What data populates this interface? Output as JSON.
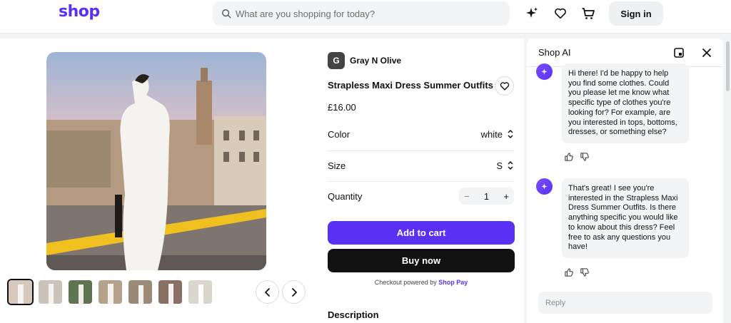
{
  "header": {
    "logo": "shop",
    "search_placeholder": "What are you shopping for today?",
    "signin_label": "Sign in"
  },
  "product": {
    "seller_initial": "G",
    "seller_name": "Gray N Olive",
    "title": "Strapless Maxi Dress Summer Outfits",
    "price": "£16.00",
    "color_label": "Color",
    "color_value": "white",
    "size_label": "Size",
    "size_value": "S",
    "quantity_label": "Quantity",
    "quantity_value": "1",
    "add_to_cart": "Add to cart",
    "buy_now": "Buy now",
    "checkout_prefix": "Checkout powered by",
    "checkout_brand": "Shop Pay",
    "description_label": "Description"
  },
  "ai": {
    "title": "Shop AI",
    "messages": [
      "Hi there! I'd be happy to help you find some clothes. Could you please let me know what specific type of clothes you're looking for? For example, are you interested in tops, bottoms, dresses, or something else?",
      "That's great! I see you're interested in the Strapless Maxi Dress Summer Outfits. Is there anything specific you would like to know about this dress? Feel free to ask any questions you have!"
    ],
    "reply_placeholder": "Reply"
  },
  "colors": {
    "brand": "#5a31f4",
    "buy_now": "#111111",
    "background": "#f2f4f5"
  }
}
